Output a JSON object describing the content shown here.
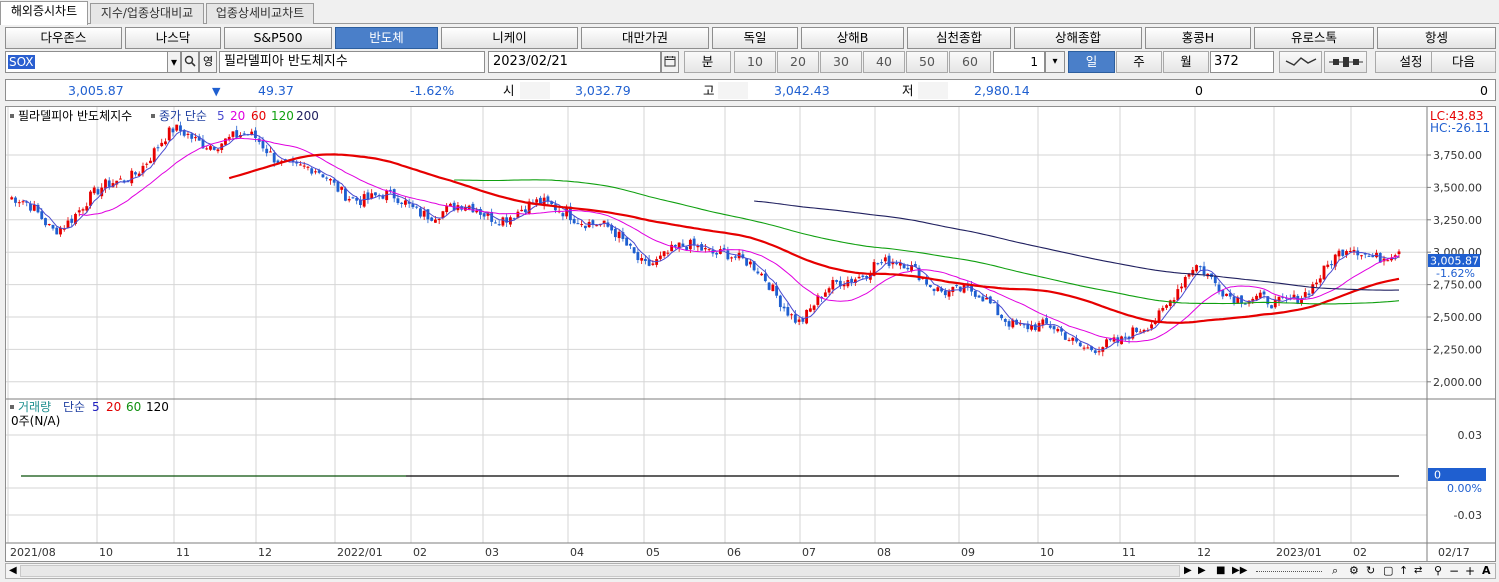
{
  "tabs": [
    "해외증시차트",
    "지수/업종상대비교",
    "업종상세비교차트"
  ],
  "markets": [
    "다우존스",
    "나스닥",
    "S&P500",
    "반도체",
    "니케이",
    "대만가권",
    "독일",
    "상해B",
    "심천종합",
    "상해종합",
    "홍콩H",
    "유로스톡",
    "항셍"
  ],
  "controls": {
    "symbol": "SOX",
    "name_prefix": "영",
    "index_name": "필라델피아 반도체지수",
    "date": "2023/02/21",
    "minute_label": "분",
    "minute_options": [
      "10",
      "20",
      "30",
      "40",
      "50",
      "60"
    ],
    "tick_value": "1",
    "period_buttons": [
      "일",
      "주",
      "월"
    ],
    "count": "372",
    "settings_label": "설정",
    "next_label": "다음"
  },
  "quote": {
    "price": "3,005.87",
    "change": "49.37",
    "change_pct": "-1.62%",
    "open_label": "시",
    "open": "3,032.79",
    "high_label": "고",
    "high": "3,042.43",
    "low_label": "저",
    "low": "2,980.14",
    "vol1": "0",
    "vol2": "0"
  },
  "price_panel": {
    "legend_title": "필라델피아 반도체지수",
    "legend_ma_prefix": "종가 단순",
    "ma_labels": [
      "5",
      "20",
      "60",
      "120",
      "200"
    ],
    "ma_colors": [
      "#4b4bd0",
      "#e000e0",
      "#e60000",
      "#10a010",
      "#202060"
    ],
    "lc": "LC:43.83",
    "hc": "HC:-26.11",
    "yticks": [
      "3,750.00",
      "3,500.00",
      "3,250.00",
      "3,000.00",
      "2,750.00",
      "2,500.00",
      "2,250.00",
      "2,000.00"
    ],
    "last_price_tag": "3,005.87",
    "last_pct_tag": "-1.62%",
    "up_color": "#e60000",
    "down_color": "#1f5fd0"
  },
  "volume_panel": {
    "legend_title": "거래량",
    "legend_ma_prefix": "단순",
    "ma_labels": [
      "5",
      "20",
      "60",
      "120"
    ],
    "ma_colors": [
      "#2020c0",
      "#e00000",
      "#109010",
      "#000000"
    ],
    "sub_label": "0주(N/A)",
    "yticks": [
      "0.03",
      "0.00%",
      "-0.03"
    ],
    "zero_tag": "0"
  },
  "x_axis": [
    "2021/08",
    "10",
    "11",
    "12",
    "2022/01",
    "02",
    "03",
    "04",
    "05",
    "06",
    "07",
    "08",
    "09",
    "10",
    "11",
    "12",
    "2023/01",
    "02",
    "02/17"
  ],
  "chart_data": {
    "type": "candlestick",
    "title": "필라델피아 반도체지수",
    "x_range": [
      "2021/08",
      "2023/02/21"
    ],
    "ylim": [
      1950,
      4050
    ],
    "monthly_closes": {
      "2021/08": 3420,
      "2021/09": 3200,
      "2021/10": 3420,
      "2021/11": 3900,
      "2021/12": 3850,
      "2022/01": 3500,
      "2022/02": 3350,
      "2022/03": 3300,
      "2022/04": 3350,
      "2022/05": 2950,
      "2022/06": 3050,
      "2022/07": 2500,
      "2022/08": 2950,
      "2022/09": 2700,
      "2022/10": 2400,
      "2022/11": 2250,
      "2022/12": 2850,
      "2023/01": 2550,
      "2023/02": 3010
    },
    "last": {
      "date": "2023/02/21",
      "open": 3032.79,
      "high": 3042.43,
      "low": 2980.14,
      "close": 3005.87,
      "change": -49.37,
      "change_pct": -1.62
    }
  }
}
